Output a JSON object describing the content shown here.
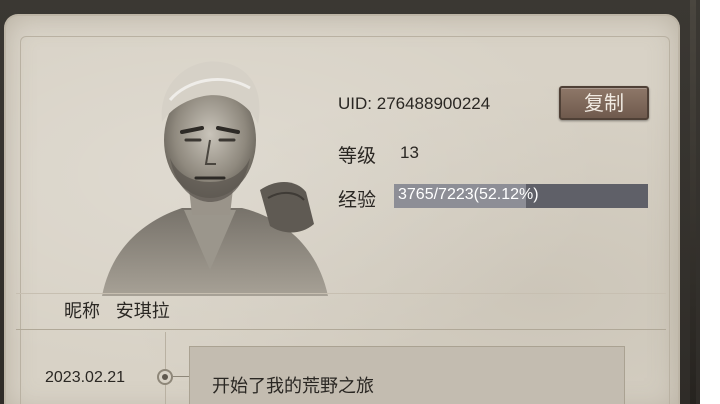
{
  "profile": {
    "uid_label": "UID:",
    "uid_value": "276488900224",
    "copy_label": "复制",
    "level_label": "等级",
    "level_value": "13",
    "xp_label": "经验",
    "xp_text": "3765/7223(52.12%)",
    "xp_fraction": 0.5212,
    "nickname_label": "昵称",
    "nickname_value": "安琪拉"
  },
  "timeline": {
    "entries": [
      {
        "date": "2023.02.21",
        "text": "开始了我的荒野之旅"
      }
    ]
  },
  "colors": {
    "panel": "#d8d2c6",
    "copy_button": "#7d6759",
    "xp_track": "#5f6068",
    "xp_fill": "#8d8e96"
  }
}
